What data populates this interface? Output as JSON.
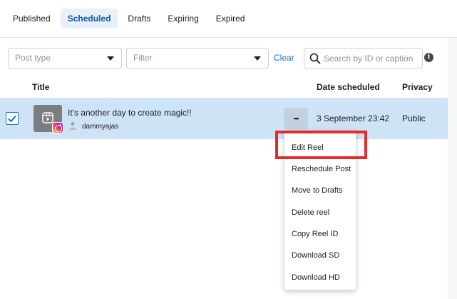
{
  "tabs": [
    {
      "label": "Published",
      "active": false
    },
    {
      "label": "Scheduled",
      "active": true
    },
    {
      "label": "Drafts",
      "active": false
    },
    {
      "label": "Expiring",
      "active": false
    },
    {
      "label": "Expired",
      "active": false
    }
  ],
  "filters": {
    "post_type_placeholder": "Post type",
    "filter_placeholder": "Filter",
    "clear_label": "Clear",
    "search_placeholder": "Search by ID or caption",
    "info_glyph": "i"
  },
  "table": {
    "headers": {
      "title": "Title",
      "date": "Date scheduled",
      "privacy": "Privacy"
    },
    "rows": [
      {
        "checked": true,
        "title": "It's another day to create magic!!",
        "account": "dammyajas",
        "more_glyph": "•••",
        "date": "3 September 23:42",
        "privacy": "Public"
      }
    ]
  },
  "menu": {
    "items": [
      "Edit Reel",
      "Reschedule Post",
      "Move to Drafts",
      "Delete reel",
      "Copy Reel ID",
      "Download SD",
      "Download HD"
    ],
    "highlighted": "Edit Reel"
  },
  "colors": {
    "accent": "#1a73c8",
    "selected_row": "#cfe3f7",
    "highlight": "#e32b2b"
  },
  "icons": [
    "search-icon",
    "info-icon",
    "chevron-down-icon",
    "check-icon",
    "reel-icon",
    "instagram-icon",
    "more-icon"
  ]
}
